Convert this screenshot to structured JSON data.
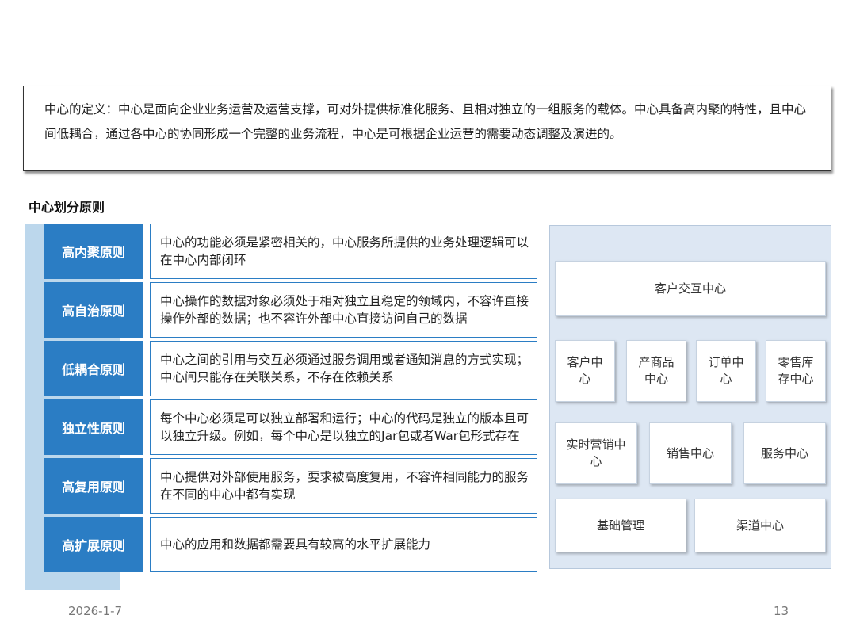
{
  "definition": "中心的定义：中心是面向企业业务运营及运营支撑，可对外提供标准化服务、且相对独立的一组服务的载体。中心具备高内聚的特性，且中心间低耦合，通过各中心的协同形成一个完整的业务流程，中心是可根据企业运营的需要动态调整及演进的。",
  "section_title": "中心划分原则",
  "principles": [
    {
      "name": "高内聚原则",
      "desc": "中心的功能必须是紧密相关的，中心服务所提供的业务处理逻辑可以在中心内部闭环"
    },
    {
      "name": "高自治原则",
      "desc": "中心操作的数据对象必须处于相对独立且稳定的领域内，不容许直接操作外部的数据；也不容许外部中心直接访问自己的数据"
    },
    {
      "name": "低耦合原则",
      "desc": "中心之间的引用与交互必须通过服务调用或者通知消息的方式实现；中心间只能存在关联关系，不存在依赖关系"
    },
    {
      "name": "独立性原则",
      "desc": "每个中心必须是可以独立部署和运行；中心的代码是独立的版本且可以独立升级。例如，每个中心是以独立的Jar包或者War包形式存在"
    },
    {
      "name": "高复用原则",
      "desc": "中心提供对外部使用服务，要求被高度复用，不容许相同能力的服务在不同的中心中都有实现"
    },
    {
      "name": "高扩展原则",
      "desc": "中心的应用和数据都需要具有较高的水平扩展能力"
    }
  ],
  "centers": {
    "top": "客户交互中心",
    "row1": [
      "客户中心",
      "产商品中心",
      "订单中心",
      "零售库存中心"
    ],
    "row2": [
      "实时营销中心",
      "销售中心",
      "服务中心"
    ],
    "row3": [
      "基础管理",
      "渠道中心"
    ]
  },
  "footer": {
    "date": "2026-1-7",
    "page": "13"
  },
  "colors": {
    "principle_fill": "#2b7dc4",
    "left_band": "#bcd7ec",
    "panel_bg": "#dde7f3"
  }
}
